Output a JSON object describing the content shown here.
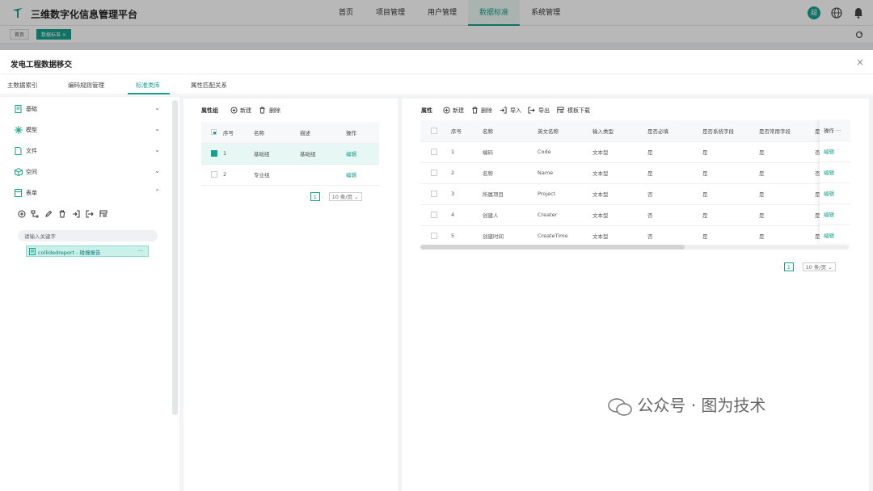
{
  "app": {
    "title": "三维数字化信息管理平台",
    "user_initial": "超"
  },
  "nav": {
    "items": [
      "首页",
      "项目管理",
      "用户管理",
      "数据标准",
      "系统管理"
    ],
    "active_index": 3
  },
  "tags": {
    "home": "首页",
    "current": "数据标准 ×"
  },
  "modal": {
    "title": "发电工程数据移交",
    "close": "×"
  },
  "tabs": [
    "主数据索引",
    "编码规则管理",
    "标准类库",
    "属性匹配关系"
  ],
  "tree": {
    "items": [
      {
        "label": "基础",
        "expanded": false,
        "icon": "doc-icon"
      },
      {
        "label": "模型",
        "expanded": false,
        "icon": "model-icon"
      },
      {
        "label": "文件",
        "expanded": false,
        "icon": "file-icon"
      },
      {
        "label": "空间",
        "expanded": false,
        "icon": "space-icon"
      },
      {
        "label": "表单",
        "expanded": true,
        "icon": "form-icon"
      }
    ],
    "search_placeholder": "请输入关键字",
    "leaf": {
      "label": "collidedreport - 碰撞报告",
      "more": "···"
    }
  },
  "attr_group": {
    "title": "属性组",
    "add": "新建",
    "delete": "删除",
    "columns": [
      "序号",
      "名称",
      "描述",
      "操作"
    ],
    "rows": [
      {
        "no": "1",
        "name": "基础组",
        "desc": "基础组",
        "op": "编辑",
        "checked": true
      },
      {
        "no": "2",
        "name": "专业组",
        "desc": "",
        "op": "编辑",
        "checked": false
      }
    ],
    "pager": {
      "page": "1",
      "size": "10 条/页"
    }
  },
  "attributes": {
    "title": "属性",
    "toolbar": [
      "新建",
      "删除",
      "导入",
      "导出",
      "模板下载"
    ],
    "columns": [
      "序号",
      "名称",
      "英文名称",
      "输入类型",
      "是否必填",
      "是否系统字段",
      "是否常用字段",
      "是",
      "操作"
    ],
    "rows": [
      {
        "no": "1",
        "name": "编码",
        "en": "Code",
        "type": "文本型",
        "req": "是",
        "sys": "是",
        "common": "是",
        "x": "否",
        "op": "编辑"
      },
      {
        "no": "2",
        "name": "名称",
        "en": "Name",
        "type": "文本型",
        "req": "是",
        "sys": "是",
        "common": "是",
        "x": "否",
        "op": "编辑"
      },
      {
        "no": "3",
        "name": "所属项目",
        "en": "Project",
        "type": "文本型",
        "req": "否",
        "sys": "是",
        "common": "是",
        "x": "是",
        "op": "编辑"
      },
      {
        "no": "4",
        "name": "创建人",
        "en": "Creater",
        "type": "文本型",
        "req": "否",
        "sys": "是",
        "common": "是",
        "x": "是",
        "op": "编辑"
      },
      {
        "no": "5",
        "name": "创建时间",
        "en": "CreateTime",
        "type": "文本型",
        "req": "否",
        "sys": "是",
        "common": "是",
        "x": "是",
        "op": "编辑"
      }
    ],
    "more": "···",
    "pager": {
      "page": "1",
      "size": "10 条/页"
    }
  },
  "watermark": "公众号 · 图为技术",
  "colors": {
    "accent": "#17a08c"
  }
}
